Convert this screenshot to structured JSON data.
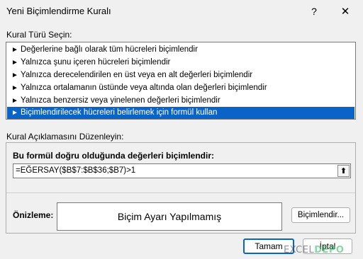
{
  "window": {
    "title": "Yeni Biçimlendirme Kuralı",
    "help_glyph": "?",
    "close_glyph": "✕"
  },
  "rule_type": {
    "label": "Kural Türü Seçin:",
    "items": [
      {
        "label": "Değerlerine bağlı olarak tüm hücreleri biçimlendir"
      },
      {
        "label": "Yalnızca şunu içeren hücreleri biçimlendir"
      },
      {
        "label": "Yalnızca derecelendirilen en üst veya en alt değerleri biçimlendir"
      },
      {
        "label": "Yalnızca ortalamanın üstünde veya altında olan değerleri biçimlendir"
      },
      {
        "label": "Yalnızca benzersiz veya yinelenen değerleri biçimlendir"
      },
      {
        "label": "Biçimlendirilecek hücreleri belirlemek için formül kullan"
      }
    ],
    "selected_index": 5,
    "item_arrow": "►"
  },
  "description": {
    "label": "Kural Açıklamasını Düzenleyin:",
    "formula_heading": "Bu formül doğru olduğunda değerleri biçimlendir:",
    "formula_value": "=EĞERSAY($B$7:$B$36;$B7)>1",
    "collapse_glyph": "⬆",
    "preview_label": "Önizleme:",
    "preview_text": "Biçim Ayarı Yapılmamış",
    "format_button_label": "Biçimlendir..."
  },
  "buttons": {
    "ok_label": "Tamam",
    "cancel_label": "İptal"
  },
  "watermark": {
    "text_1": "EXCEL",
    "text_2": "DEPO"
  },
  "colors": {
    "selection": "#0a64c7",
    "dialog_bg": "#f0f0f0"
  }
}
